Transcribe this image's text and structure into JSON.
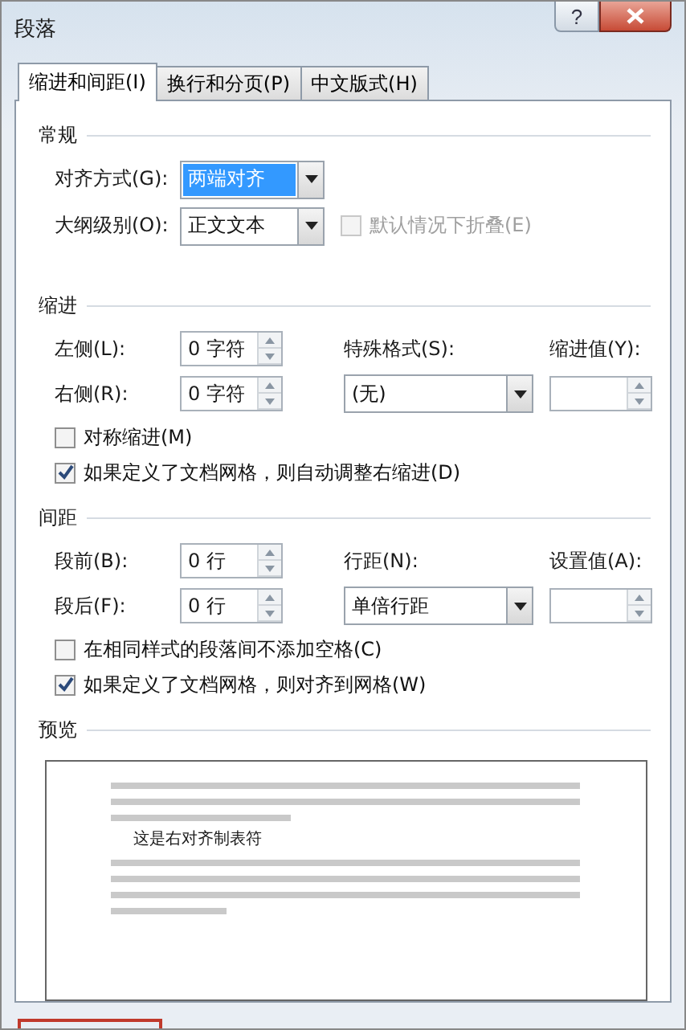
{
  "window": {
    "title": "段落",
    "help_button": "?"
  },
  "tabs": [
    {
      "label": "缩进和间距(I)",
      "selected": true
    },
    {
      "label": "换行和分页(P)",
      "selected": false
    },
    {
      "label": "中文版式(H)",
      "selected": false
    }
  ],
  "general": {
    "title": "常规",
    "alignment": {
      "label": "对齐方式(G):",
      "value": "两端对齐",
      "highlighted": true
    },
    "outline": {
      "label": "大纲级别(O):",
      "value": "正文文本",
      "highlighted": false
    },
    "collapse": {
      "label": "默认情况下折叠(E)",
      "checked": false,
      "disabled": true
    }
  },
  "indent": {
    "title": "缩进",
    "left": {
      "label": "左侧(L):",
      "value": "0 字符"
    },
    "right": {
      "label": "右侧(R):",
      "value": "0 字符"
    },
    "special": {
      "label": "特殊格式(S):",
      "value": "(无)"
    },
    "by": {
      "label": "缩进值(Y):"
    },
    "checkboxes": [
      {
        "label": "对称缩进(M)",
        "checked": false,
        "disabled": false
      },
      {
        "label": "如果定义了文档网格，则自动调整右缩进(D)",
        "checked": true,
        "disabled": false
      }
    ]
  },
  "spacing": {
    "title": "间距",
    "before": {
      "label": "段前(B):",
      "value": "0 行"
    },
    "after": {
      "label": "段后(F):",
      "value": "0 行"
    },
    "line": {
      "label": "行距(N):",
      "value": "单倍行距"
    },
    "at": {
      "label": "设置值(A):"
    },
    "checkboxes": [
      {
        "label": "在相同样式的段落间不添加空格(C)",
        "checked": false,
        "disabled": false
      },
      {
        "label": "如果定义了文档网格，则对齐到网格(W)",
        "checked": true,
        "disabled": false
      }
    ]
  },
  "preview": {
    "title": "预览",
    "sample_text": "这是右对齐制表符"
  }
}
